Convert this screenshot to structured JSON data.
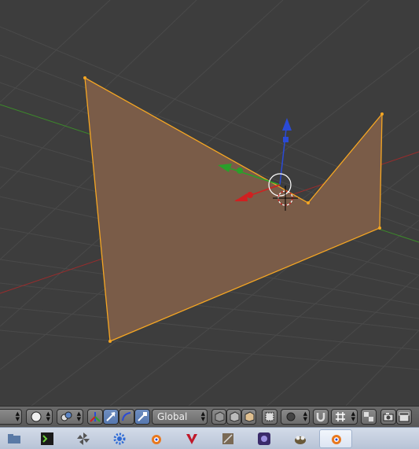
{
  "viewport": {
    "background": "#3d3d3d",
    "face_color": "#7a5c48",
    "edge_color": "#f5a623",
    "x_axis_color": "#9a2c2c",
    "y_axis_color": "#3c8a2a"
  },
  "header": {
    "orientation_label": "Global",
    "active_accent": "#5678b0"
  },
  "taskbar": {
    "apps": [
      {
        "name": "file-manager-app",
        "color": "#5a7aa6"
      },
      {
        "name": "terminal-app",
        "color": "#2a6e1c"
      },
      {
        "name": "pinwheel-app",
        "color": "#555555"
      },
      {
        "name": "blue-gear-app",
        "color": "#2d6ad6"
      },
      {
        "name": "blender-app",
        "color": "#e8781e"
      },
      {
        "name": "red-app",
        "color": "#c0192a"
      },
      {
        "name": "notepad-app",
        "color": "#7a6a55"
      },
      {
        "name": "media-app",
        "color": "#3a2a6a"
      },
      {
        "name": "gimp-app",
        "color": "#6a5a3a"
      },
      {
        "name": "blender-active-app",
        "color": "#e8781e"
      }
    ]
  }
}
